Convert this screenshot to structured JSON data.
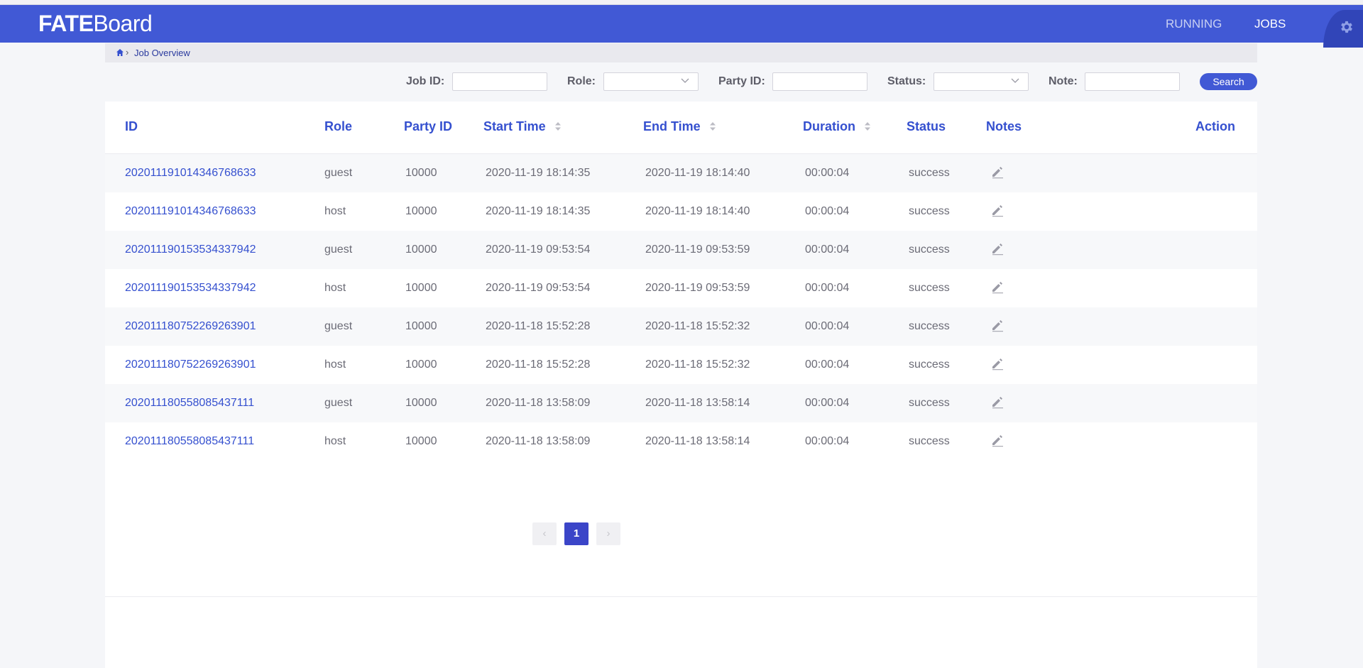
{
  "header": {
    "logo_bold": "FATE",
    "logo_rest": "Board",
    "nav": [
      "RUNNING",
      "JOBS"
    ],
    "settings_icon": "gear-icon"
  },
  "breadcrumb": {
    "home_icon": "home-icon",
    "current": "Job Overview"
  },
  "filters": {
    "job_id_label": "Job ID:",
    "job_id_value": "",
    "role_label": "Role:",
    "role_value": "",
    "party_id_label": "Party ID:",
    "party_id_value": "",
    "status_label": "Status:",
    "status_value": "",
    "note_label": "Note:",
    "note_value": "",
    "search_label": "Search"
  },
  "table": {
    "columns": [
      "ID",
      "Role",
      "Party ID",
      "Start Time",
      "End Time",
      "Duration",
      "Status",
      "Notes",
      "Action"
    ],
    "rows": [
      {
        "id": "202011191014346768633",
        "role": "guest",
        "party_id": "10000",
        "start": "2020-11-19 18:14:35",
        "end": "2020-11-19 18:14:40",
        "duration": "00:00:04",
        "status": "success"
      },
      {
        "id": "202011191014346768633",
        "role": "host",
        "party_id": "10000",
        "start": "2020-11-19 18:14:35",
        "end": "2020-11-19 18:14:40",
        "duration": "00:00:04",
        "status": "success"
      },
      {
        "id": "202011190153534337942",
        "role": "guest",
        "party_id": "10000",
        "start": "2020-11-19 09:53:54",
        "end": "2020-11-19 09:53:59",
        "duration": "00:00:04",
        "status": "success"
      },
      {
        "id": "202011190153534337942",
        "role": "host",
        "party_id": "10000",
        "start": "2020-11-19 09:53:54",
        "end": "2020-11-19 09:53:59",
        "duration": "00:00:04",
        "status": "success"
      },
      {
        "id": "202011180752269263901",
        "role": "guest",
        "party_id": "10000",
        "start": "2020-11-18 15:52:28",
        "end": "2020-11-18 15:52:32",
        "duration": "00:00:04",
        "status": "success"
      },
      {
        "id": "202011180752269263901",
        "role": "host",
        "party_id": "10000",
        "start": "2020-11-18 15:52:28",
        "end": "2020-11-18 15:52:32",
        "duration": "00:00:04",
        "status": "success"
      },
      {
        "id": "202011180558085437111",
        "role": "guest",
        "party_id": "10000",
        "start": "2020-11-18 13:58:09",
        "end": "2020-11-18 13:58:14",
        "duration": "00:00:04",
        "status": "success"
      },
      {
        "id": "202011180558085437111",
        "role": "host",
        "party_id": "10000",
        "start": "2020-11-18 13:58:09",
        "end": "2020-11-18 13:58:14",
        "duration": "00:00:04",
        "status": "success"
      }
    ]
  },
  "pagination": {
    "prev": "‹",
    "current": "1",
    "next": "›"
  },
  "colors": {
    "brand": "#4159d5",
    "link": "#3550cf",
    "page_active": "#3b45c8"
  }
}
